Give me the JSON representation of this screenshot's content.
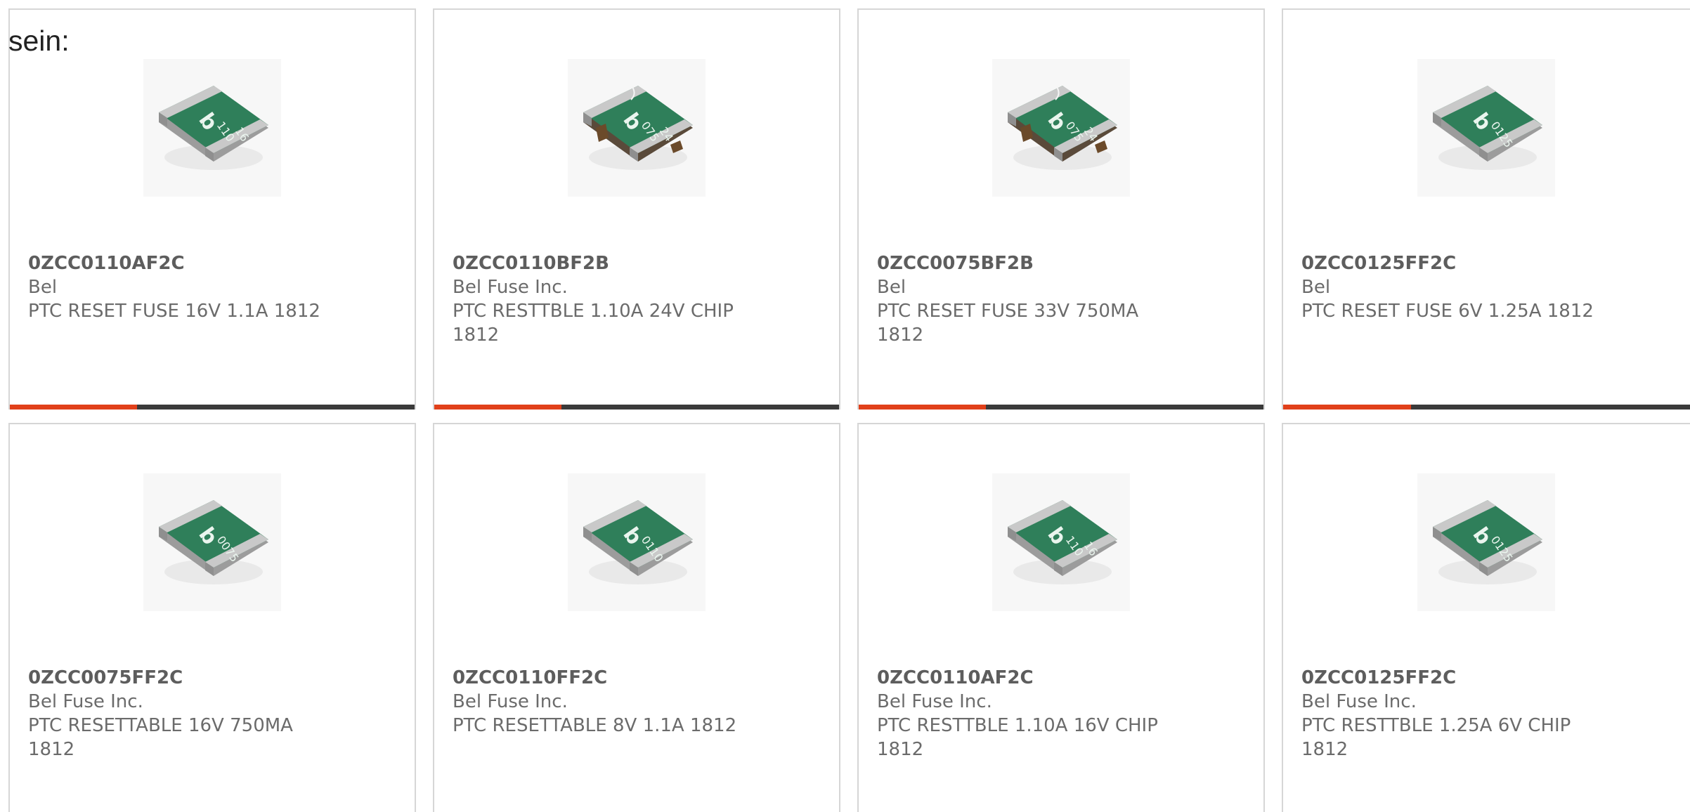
{
  "intro_text": "sein:",
  "accent_color": "#e1401a",
  "bar_color": "#3a3a3a",
  "products": [
    {
      "part_number": "0ZCC0110AF2C",
      "manufacturer": "Bel",
      "description": "PTC RESET FUSE 16V 1.1A 1812",
      "marking": [
        "b",
        "110",
        "16"
      ],
      "notched": false
    },
    {
      "part_number": "0ZCC0110BF2B",
      "manufacturer": "Bel Fuse Inc.",
      "description": "PTC RESTTBLE 1.10A 24V CHIP 1812",
      "marking": [
        "b",
        "075",
        "24"
      ],
      "notched": true
    },
    {
      "part_number": "0ZCC0075BF2B",
      "manufacturer": "Bel",
      "description": "PTC RESET FUSE 33V 750MA 1812",
      "marking": [
        "b",
        "075",
        "24"
      ],
      "notched": true
    },
    {
      "part_number": "0ZCC0125FF2C",
      "manufacturer": "Bel",
      "description": "PTC RESET FUSE 6V 1.25A 1812",
      "marking": [
        "b",
        "0125"
      ],
      "notched": false
    },
    {
      "part_number": "0ZCC0075FF2C",
      "manufacturer": "Bel Fuse Inc.",
      "description": "PTC RESETTABLE 16V 750MA 1812",
      "marking": [
        "b",
        "0075"
      ],
      "notched": false
    },
    {
      "part_number": "0ZCC0110FF2C",
      "manufacturer": "Bel Fuse Inc.",
      "description": "PTC RESETTABLE 8V 1.1A 1812",
      "marking": [
        "b",
        "0110"
      ],
      "notched": false
    },
    {
      "part_number": "0ZCC0110AF2C",
      "manufacturer": "Bel Fuse Inc.",
      "description": "PTC RESTTBLE 1.10A 16V CHIP 1812",
      "marking": [
        "b",
        "110",
        "16"
      ],
      "notched": false
    },
    {
      "part_number": "0ZCC0125FF2C",
      "manufacturer": "Bel Fuse Inc.",
      "description": "PTC RESTTBLE 1.25A 6V CHIP 1812",
      "marking": [
        "b",
        "0125"
      ],
      "notched": false
    }
  ]
}
